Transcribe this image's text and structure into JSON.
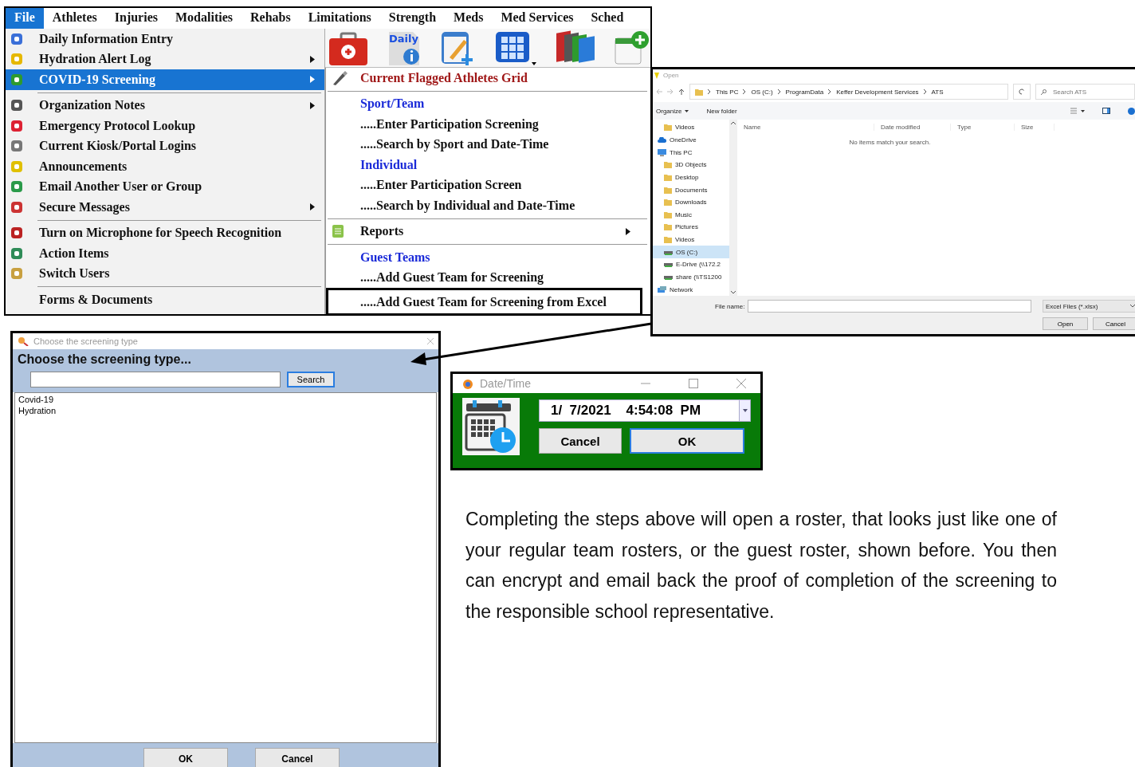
{
  "app_menu": {
    "toolbar": {
      "daily_icon_text": "Daily"
    },
    "menubar": [
      {
        "label": "File",
        "selected": true
      },
      {
        "label": "Athletes",
        "selected": false
      },
      {
        "label": "Injuries",
        "selected": false
      },
      {
        "label": "Modalities",
        "selected": false
      },
      {
        "label": "Rehabs",
        "selected": false
      },
      {
        "label": "Limitations",
        "selected": false
      },
      {
        "label": "Strength",
        "selected": false
      },
      {
        "label": "Meds",
        "selected": false
      },
      {
        "label": "Med Services",
        "selected": false
      },
      {
        "label": "Sched",
        "selected": false
      }
    ],
    "file_menu": [
      {
        "kind": "item",
        "label": "Daily Information Entry",
        "icon": true,
        "submenu": false,
        "selected": false
      },
      {
        "kind": "item",
        "label": "Hydration Alert Log",
        "icon": true,
        "submenu": true,
        "selected": false
      },
      {
        "kind": "item",
        "label": "COVID-19 Screening",
        "icon": true,
        "submenu": true,
        "selected": true
      },
      {
        "kind": "separator"
      },
      {
        "kind": "item",
        "label": "Organization Notes",
        "icon": true,
        "submenu": true,
        "selected": false
      },
      {
        "kind": "item",
        "label": "Emergency Protocol Lookup",
        "icon": true,
        "submenu": false,
        "selected": false
      },
      {
        "kind": "item",
        "label": "Current Kiosk/Portal Logins",
        "icon": true,
        "submenu": false,
        "selected": false
      },
      {
        "kind": "item",
        "label": "Announcements",
        "icon": true,
        "submenu": false,
        "selected": false
      },
      {
        "kind": "item",
        "label": "Email Another User or Group",
        "icon": true,
        "submenu": false,
        "selected": false
      },
      {
        "kind": "item",
        "label": "Secure Messages",
        "icon": true,
        "submenu": true,
        "selected": false
      },
      {
        "kind": "separator"
      },
      {
        "kind": "item",
        "label": "Turn on Microphone for Speech Recognition",
        "icon": true,
        "submenu": false,
        "selected": false
      },
      {
        "kind": "item",
        "label": "Action Items",
        "icon": true,
        "submenu": false,
        "selected": false
      },
      {
        "kind": "item",
        "label": "Switch Users",
        "icon": true,
        "submenu": false,
        "selected": false
      },
      {
        "kind": "separator"
      },
      {
        "kind": "item",
        "label": "Forms & Documents",
        "icon": false,
        "submenu": false,
        "selected": false
      }
    ],
    "submenu": [
      {
        "kind": "flagged",
        "label": "Current Flagged Athletes Grid",
        "icon": true,
        "submenu": false,
        "outlined": false
      },
      {
        "kind": "separator"
      },
      {
        "kind": "header",
        "label": "Sport/Team",
        "icon": false,
        "submenu": false,
        "outlined": false
      },
      {
        "kind": "item",
        "label": ".....Enter Participation Screening",
        "icon": false,
        "submenu": false,
        "outlined": false
      },
      {
        "kind": "item",
        "label": ".....Search by Sport and Date-Time",
        "icon": false,
        "submenu": false,
        "outlined": false
      },
      {
        "kind": "header",
        "label": "Individual",
        "icon": false,
        "submenu": false,
        "outlined": false
      },
      {
        "kind": "item",
        "label": ".....Enter Participation Screen",
        "icon": false,
        "submenu": false,
        "outlined": false
      },
      {
        "kind": "item",
        "label": ".....Search by Individual and Date-Time",
        "icon": false,
        "submenu": false,
        "outlined": false
      },
      {
        "kind": "separator"
      },
      {
        "kind": "item",
        "label": "Reports",
        "icon": true,
        "submenu": true,
        "outlined": false
      },
      {
        "kind": "separator"
      },
      {
        "kind": "header",
        "label": "Guest Teams",
        "icon": false,
        "submenu": false,
        "outlined": false
      },
      {
        "kind": "item",
        "label": ".....Add Guest Team for Screening",
        "icon": false,
        "submenu": false,
        "outlined": false
      },
      {
        "kind": "item",
        "label": ".....Add Guest Team for Screening from Excel",
        "icon": false,
        "submenu": false,
        "outlined": true
      }
    ]
  },
  "file_dialog": {
    "title": "Open",
    "breadcrumb": [
      "This PC",
      "OS (C:)",
      "ProgramData",
      "Keffer Development Services",
      "ATS"
    ],
    "search": {
      "placeholder": "Search ATS"
    },
    "toolbar": [
      "Organize",
      "New folder"
    ],
    "nav_pane": [
      {
        "kind": "folder",
        "label": "Videos",
        "selected": false
      },
      {
        "kind": "cloud",
        "label": "OneDrive",
        "selected": false
      },
      {
        "kind": "computer",
        "label": "This PC",
        "selected": false,
        "children": [
          {
            "kind": "folder",
            "label": "3D Objects",
            "selected": false
          },
          {
            "kind": "folder",
            "label": "Desktop",
            "selected": false
          },
          {
            "kind": "folder",
            "label": "Documents",
            "selected": false
          },
          {
            "kind": "folder",
            "label": "Downloads",
            "selected": false
          },
          {
            "kind": "folder",
            "label": "Music",
            "selected": false
          },
          {
            "kind": "folder",
            "label": "Pictures",
            "selected": false
          },
          {
            "kind": "folder",
            "label": "Videos",
            "selected": false
          },
          {
            "kind": "drive",
            "label": "OS (C:)",
            "selected": true
          },
          {
            "kind": "drive",
            "label": "E-Drive (\\\\172.2",
            "selected": false
          },
          {
            "kind": "drive",
            "label": "share (\\\\TS1200",
            "selected": false
          }
        ]
      },
      {
        "kind": "network",
        "label": "Network",
        "selected": false
      }
    ],
    "columns": [
      "Name",
      "Date modified",
      "Type",
      "Size"
    ],
    "empty_message": "No items match your search.",
    "file_name_label": "File name:",
    "file_type": "Excel Files (*.xlsx)",
    "buttons": [
      "Open",
      "Cancel"
    ]
  },
  "screening_dialog": {
    "title": "Choose the screening type",
    "heading": "Choose the screening type...",
    "search_button": {
      "label": "Search",
      "default": true
    },
    "items": [
      "Covid-19",
      "Hydration"
    ],
    "buttons": [
      {
        "label": "OK",
        "default": false
      },
      {
        "label": "Cancel",
        "default": false
      }
    ]
  },
  "datetime_dialog": {
    "title": "Date/Time",
    "value": "1/  7/2021    4:54:08  PM",
    "buttons": [
      {
        "label": "Cancel",
        "default": false
      },
      {
        "label": "OK",
        "default": true
      }
    ]
  },
  "paragraph": "Completing the steps above will open a roster, that looks just like one of your regular team rosters, or the guest roster, shown before. You then can encrypt and email back the proof of completion of the screening to the responsible school representative."
}
